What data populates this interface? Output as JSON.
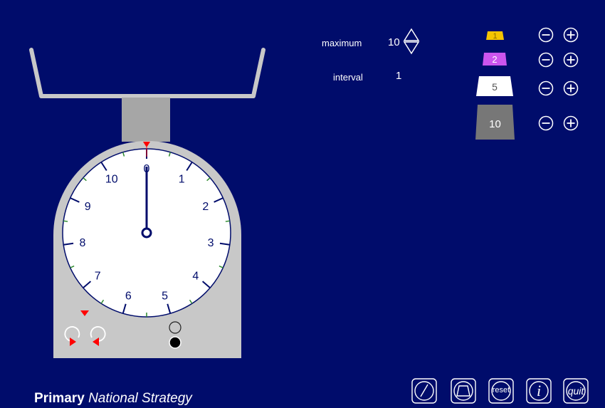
{
  "controls": {
    "maximum_label": "maximum",
    "maximum_value": "10",
    "interval_label": "interval",
    "interval_value": "1"
  },
  "weights": [
    {
      "label": "1",
      "color": "#f5c400",
      "text_color": "#8a6a00"
    },
    {
      "label": "2",
      "color": "#cc55ee",
      "text_color": "#ffffff"
    },
    {
      "label": "5",
      "color": "#ffffff",
      "text_color": "#555555"
    },
    {
      "label": "10",
      "color": "#777777",
      "text_color": "#ffffff"
    }
  ],
  "dial": {
    "numbers": [
      "0",
      "1",
      "2",
      "3",
      "4",
      "5",
      "6",
      "7",
      "8",
      "9",
      "10"
    ],
    "reading": 0,
    "maximum": 10
  },
  "toolbar": {
    "reset_label": "reset",
    "info_label": "i",
    "quit_label": "quit"
  },
  "footer": {
    "brand_bold": "Primary",
    "brand_italic": "National Strategy"
  },
  "colors": {
    "background": "#000c6b",
    "scale_body": "#c8c8c8",
    "pointer": "#000c6b",
    "marker": "#ff0000"
  }
}
